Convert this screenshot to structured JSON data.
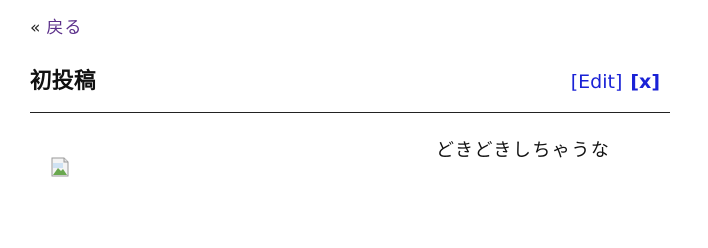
{
  "nav": {
    "back_chevron": "«",
    "back_label": "戻る"
  },
  "post": {
    "title": "初投稿",
    "edit_label": "[Edit]",
    "close_label": "[x]",
    "body_text": "どきどきしちゃうな",
    "image_icon": "broken-image-icon"
  },
  "colors": {
    "link_visited": "#5b2f8a",
    "link": "#1a22d6",
    "text": "#111111"
  }
}
